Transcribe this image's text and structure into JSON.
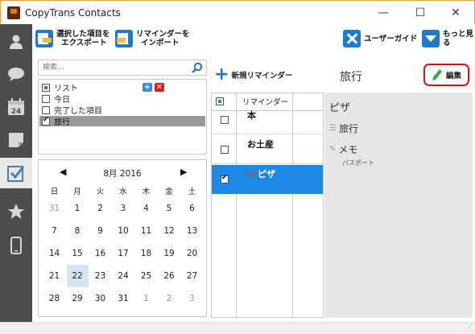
{
  "window": {
    "title": "CopyTrans Contacts",
    "minimize": "—",
    "maximize": "☐",
    "close": "✕"
  },
  "sidebar": {
    "items": [
      {
        "icon": "person-icon"
      },
      {
        "icon": "chat-bubble-icon"
      },
      {
        "icon": "calendar-icon",
        "label": "24"
      },
      {
        "icon": "note-icon"
      },
      {
        "icon": "checkbox-icon",
        "active": true
      },
      {
        "icon": "star-icon"
      },
      {
        "icon": "phone-icon"
      }
    ]
  },
  "toolbar": {
    "export_label_1": "選択した項目を",
    "export_label_2": "エクスポート",
    "import_label_1": "リマインダーを",
    "import_label_2": "インポート",
    "guide_label": "ユーザーガイド",
    "more_label": "もっと見る"
  },
  "search": {
    "placeholder": "検索..."
  },
  "lists": {
    "header": "リスト",
    "items": [
      {
        "label": "今日",
        "checked": false
      },
      {
        "label": "完了した項目",
        "checked": false
      },
      {
        "label": "旅行",
        "checked": true,
        "selected": true
      }
    ],
    "add_icon": "+",
    "delete_icon": "✕"
  },
  "calendar": {
    "title": "8月 2016",
    "prev": "◀",
    "next": "▶",
    "weekdays": [
      "日",
      "月",
      "火",
      "水",
      "木",
      "金",
      "土"
    ],
    "weeks": [
      [
        "31",
        "1",
        "2",
        "3",
        "4",
        "5",
        "6"
      ],
      [
        "7",
        "8",
        "9",
        "10",
        "11",
        "12",
        "13"
      ],
      [
        "14",
        "15",
        "16",
        "17",
        "18",
        "19",
        "20"
      ],
      [
        "21",
        "22",
        "23",
        "24",
        "25",
        "26",
        "27"
      ],
      [
        "28",
        "29",
        "30",
        "31",
        "1",
        "2",
        "3"
      ]
    ],
    "today": "22"
  },
  "reminders": {
    "new_label": "新規リマインダー",
    "column_header": "リマインダー",
    "items": [
      {
        "name": "本",
        "checked": false
      },
      {
        "name": "お土産",
        "checked": false
      },
      {
        "name": "ピザ",
        "checked": true,
        "priority": "!!!",
        "selected": true
      }
    ]
  },
  "detail": {
    "list_title": "旅行",
    "edit_label": "編集",
    "title": "ピザ",
    "list_name": "旅行",
    "memo_label": "メモ",
    "memo_text": "パスポート"
  },
  "colors": {
    "sidebar": "#4d4d4d",
    "accent": "#1e88e5",
    "edit_border": "#e01010"
  }
}
